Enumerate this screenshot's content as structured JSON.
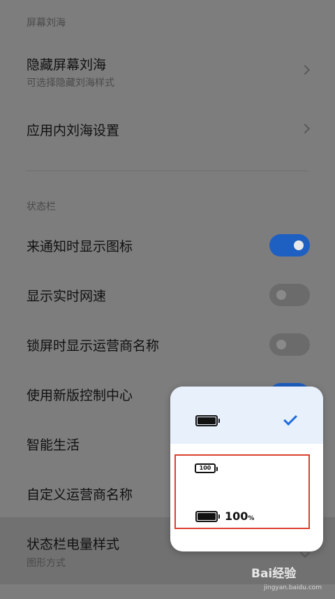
{
  "notch_section": {
    "header": "屏幕刘海",
    "items": [
      {
        "title": "隐藏屏幕刘海",
        "subtitle": "可选择隐藏刘海样式"
      },
      {
        "title": "应用内刘海设置"
      }
    ]
  },
  "status_bar_section": {
    "header": "状态栏",
    "items": [
      {
        "title": "来通知时显示图标",
        "toggle": "on"
      },
      {
        "title": "显示实时网速",
        "toggle": "off"
      },
      {
        "title": "锁屏时显示运营商名称",
        "toggle": "off"
      },
      {
        "title": "使用新版控制中心",
        "toggle": "on"
      },
      {
        "title": "智能生活"
      },
      {
        "title": "自定义运营商名称"
      },
      {
        "title": "状态栏电量样式",
        "subtitle": "图形方式"
      }
    ]
  },
  "battery_style_popup": {
    "options": [
      {
        "style": "graphic",
        "selected": true
      },
      {
        "style": "number-in-icon",
        "icon_text": "100",
        "selected": false
      },
      {
        "style": "graphic-with-percent",
        "percent_value": "100",
        "percent_sign": "%",
        "selected": false
      }
    ]
  },
  "colors": {
    "accent": "#1e6ce0",
    "toggle_on": "#1e5fc2",
    "highlight_box": "#d9412e"
  },
  "watermark": {
    "brand": "Bai经验",
    "url": "jingyan.baidu.com"
  }
}
